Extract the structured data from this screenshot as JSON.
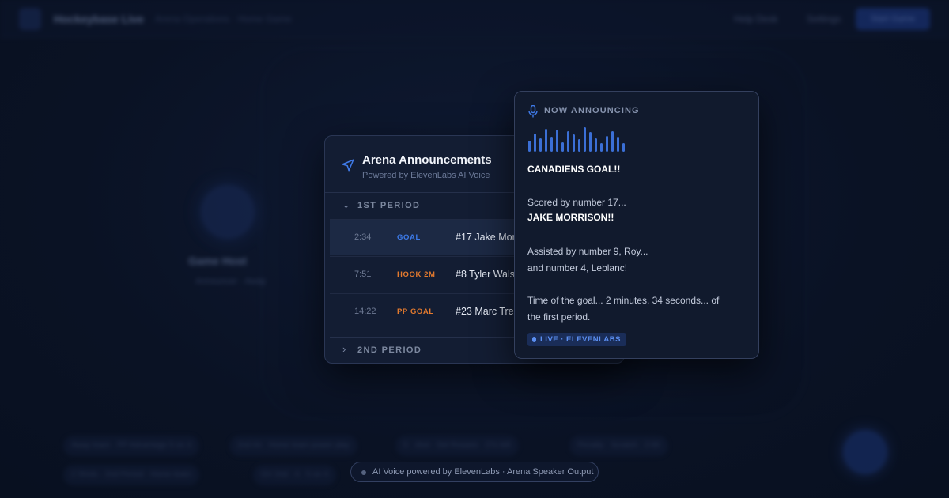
{
  "background": {
    "app_title": "Hockeybase Live",
    "app_subtitle": "Arena Operations · Home Game",
    "nav_links": [
      "Help Desk",
      "Settings"
    ],
    "cta_label": "Start Game",
    "avatar_name": "Game Host",
    "avatar_role": "Announcer · Away",
    "pills": [
      "Away team · PP Advantage 5 on 4",
      "2nd Int · Home team power play",
      "5 · shot · Del Rosario · 27s left",
      "Penalty · Scratch · 2:00",
      "2 Shots · 2nd Period · Home team",
      "GV 2nd · 4 · 5 on 4"
    ]
  },
  "panel": {
    "title": "Arena Announcements",
    "subtitle": "Powered by ElevenLabs AI Voice",
    "periods": [
      {
        "label": "1ST PERIOD",
        "expanded": true,
        "events": [
          {
            "time": "2:34",
            "type": "GOAL",
            "type_color": "#3d7bea",
            "player": "#17 Jake Morrison",
            "active": true
          },
          {
            "time": "7:51",
            "type": "HOOK 2M",
            "type_color": "#e47a2e",
            "player": "#8 Tyler Walsh",
            "active": false
          },
          {
            "time": "14:22",
            "type": "PP GOAL",
            "type_color": "#e47a2e",
            "player": "#23 Marc Tremblay",
            "active": false
          }
        ]
      },
      {
        "label": "2ND PERIOD",
        "expanded": false
      }
    ]
  },
  "announcement": {
    "label": "NOW ANNOUNCING",
    "headline": "CANADIENS GOAL!!",
    "lines": [
      "Scored by number 17...",
      "JAKE MORRISON!!",
      "Assisted by number 9, Roy...",
      "and number 4, Leblanc!",
      "Time of the goal... 2 minutes, 34 seconds... of",
      "the first period."
    ],
    "badge": "LIVE · ELEVENLABS",
    "waveform_levels": [
      0.45,
      0.75,
      0.55,
      0.95,
      0.6,
      0.9,
      0.4,
      0.85,
      0.7,
      0.5,
      1.0,
      0.8,
      0.55,
      0.35,
      0.65,
      0.85,
      0.6,
      0.35
    ],
    "accent_color": "#3b6fd6"
  },
  "footer": {
    "text": "AI Voice powered by ElevenLabs · Arena Speaker Output"
  }
}
